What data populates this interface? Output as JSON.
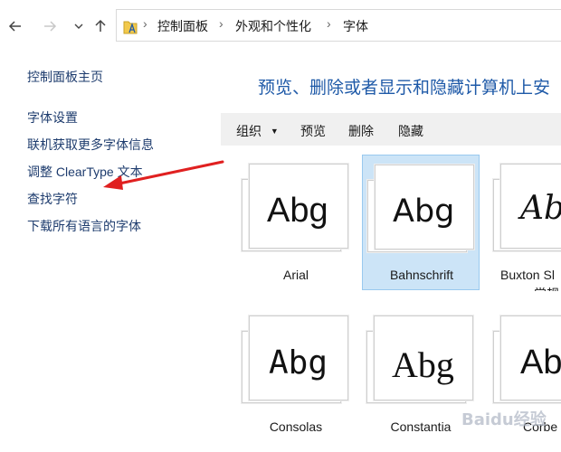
{
  "nav": {
    "back_icon": "arrow-left-icon",
    "forward_icon": "arrow-right-icon",
    "recent_icon": "chevron-down-icon",
    "up_icon": "arrow-up-icon"
  },
  "address": {
    "breadcrumbs": [
      "控制面板",
      "外观和个性化",
      "字体"
    ]
  },
  "sidebar": {
    "home": "控制面板主页",
    "links": [
      "字体设置",
      "联机获取更多字体信息",
      "调整 ClearType 文本",
      "查找字符",
      "下载所有语言的字体"
    ]
  },
  "main": {
    "heading": "预览、删除或者显示和隐藏计算机上安"
  },
  "toolbar": {
    "organize": "组织",
    "preview": "预览",
    "delete": "删除",
    "hide": "隐藏"
  },
  "fonts": [
    {
      "name": "Arial",
      "sample": "Abg"
    },
    {
      "name": "Bahnschrift",
      "sample": "Abg",
      "selected": true
    },
    {
      "name": "Buxton Sl",
      "name2": "常规",
      "sample": "Abg"
    },
    {
      "name": "Consolas",
      "sample": "Abg"
    },
    {
      "name": "Constantia",
      "sample": "Abg"
    },
    {
      "name": "Corbe",
      "sample": "Ab"
    }
  ],
  "watermark": "Baidu经验",
  "colors": {
    "link": "#1e3c6e",
    "heading": "#1f5aa8",
    "selection": "#cce4f7",
    "arrow": "#e02020"
  }
}
